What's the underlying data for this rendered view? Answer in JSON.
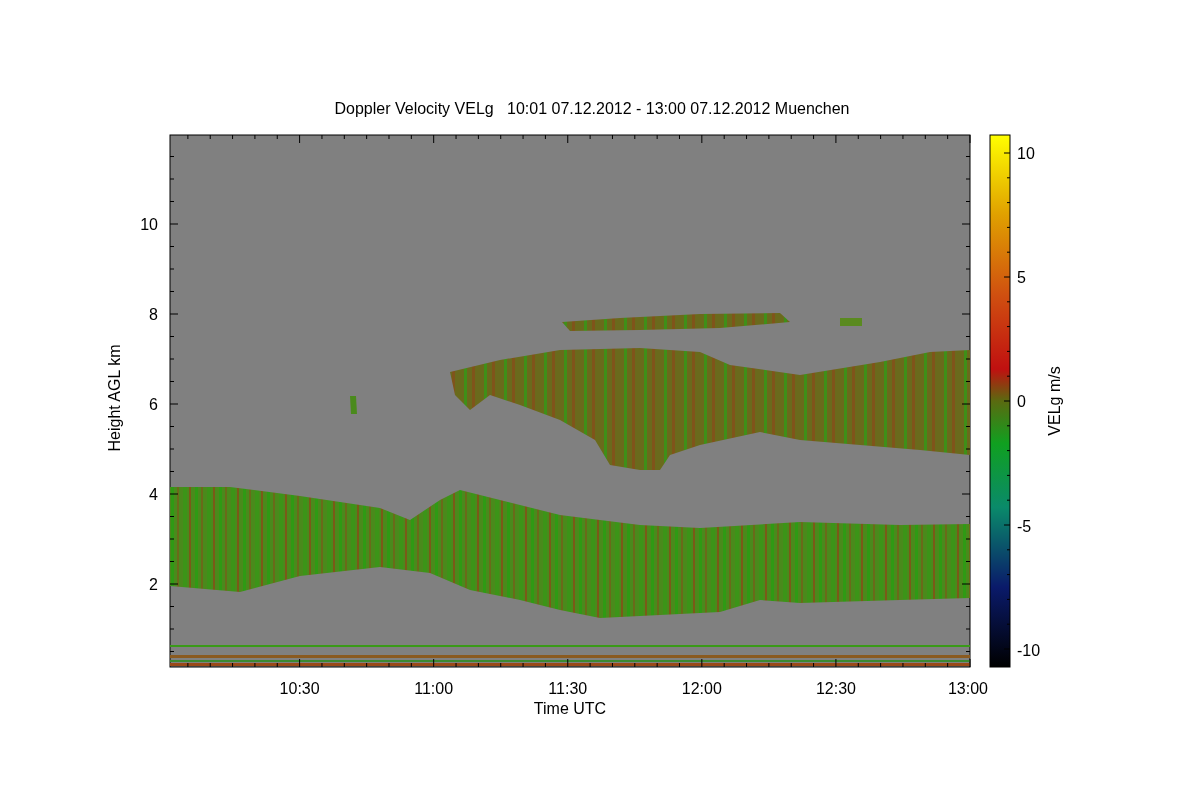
{
  "title": "Doppler Velocity VELg   10:01 07.12.2012 - 13:00 07.12.2012 Muenchen",
  "plot": {
    "xlabel": "Time UTC",
    "ylabel": "Height AGL km",
    "xticks": [
      "10:30",
      "11:00",
      "11:30",
      "12:00",
      "12:30",
      "13:00"
    ],
    "yticks": [
      "10",
      "8",
      "6",
      "4",
      "2"
    ]
  },
  "colorbar": {
    "label": "VELg m/s",
    "ticks": [
      "10",
      "5",
      "0",
      "-5",
      "-10"
    ]
  }
}
